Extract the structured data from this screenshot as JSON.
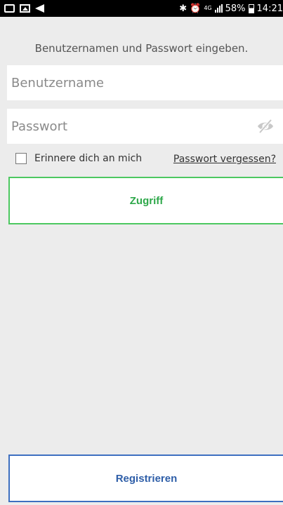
{
  "status_bar": {
    "battery_percent": "58%",
    "time": "14:21",
    "network": "4G",
    "icons": [
      "message-icon",
      "image-icon",
      "send-icon",
      "bluetooth-icon",
      "alarm-icon",
      "signal-icon",
      "battery-icon"
    ]
  },
  "login": {
    "prompt": "Benutzernamen und Passwort eingeben.",
    "username_placeholder": "Benutzername",
    "password_placeholder": "Passwort",
    "remember_label": "Erinnere dich an mich",
    "remember_checked": false,
    "forgot_label": "Passwort vergessen?",
    "submit_label": "Zugriff"
  },
  "footer": {
    "register_label": "Registrieren"
  },
  "colors": {
    "background": "#ececec",
    "accent_green": "#2ea84a",
    "accent_blue": "#2e5ea8"
  }
}
